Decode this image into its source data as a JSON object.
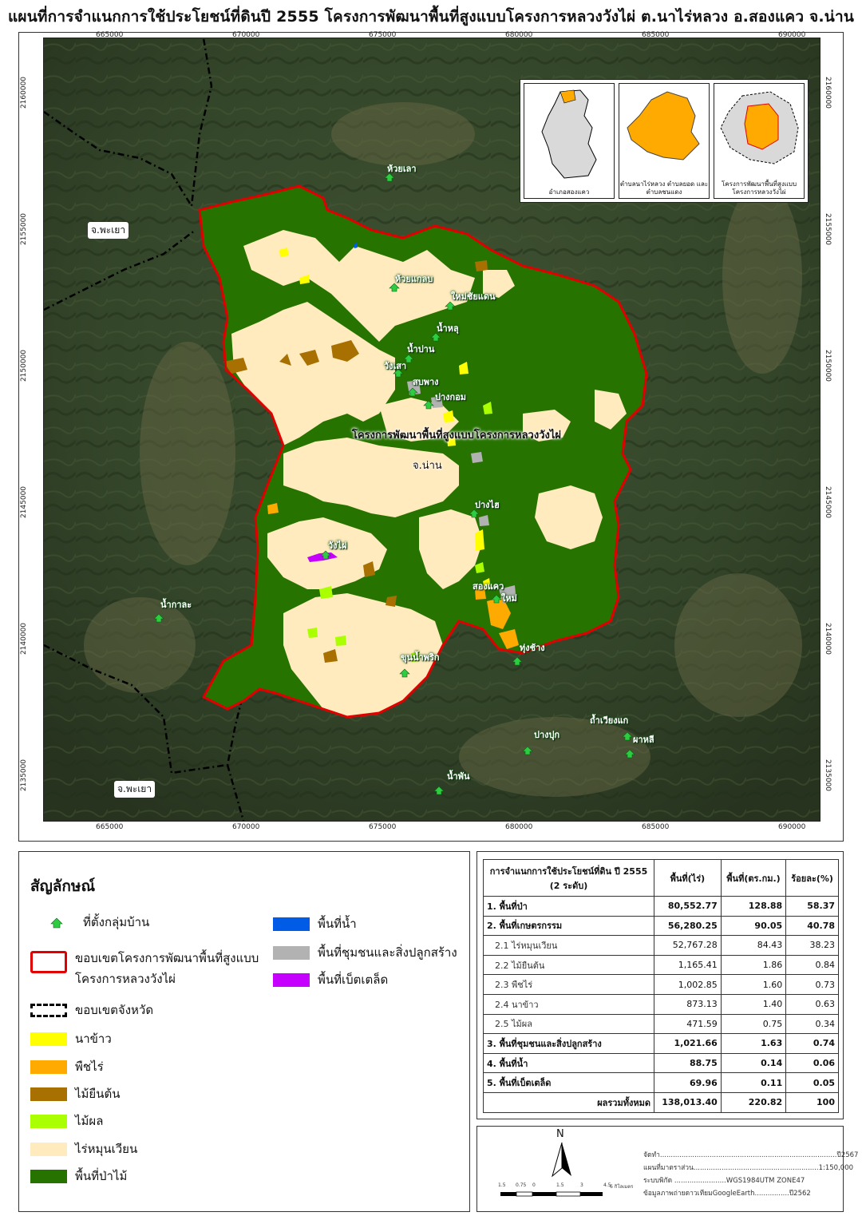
{
  "title": "แผนที่การจำแนกการใช้ประโยชน์ที่ดินปี 2555 โครงการพัฒนาพื้นที่สูงแบบโครงการหลวงวังไผ่ ต.นาไร่หลวง อ.สองแคว จ.น่าน",
  "ticks": {
    "x": [
      "665000",
      "670000",
      "675000",
      "680000",
      "685000",
      "690000"
    ],
    "y": [
      "2160000",
      "2155000",
      "2150000",
      "2145000",
      "2140000",
      "2135000"
    ]
  },
  "map_labels": {
    "provinces": [
      "จ.พะเยา",
      "จ.พะเยา",
      "จ.น่าน"
    ],
    "project": "โครงการพัฒนาพื้นที่สูงแบบโครงการหลวงวังไผ่",
    "villages": [
      "ห้วยเลา",
      "ห้วยแกลบ",
      "ใหม่ชัยแดน",
      "น้ำหลุ",
      "น้ำปาน",
      "วังเสา",
      "สบพาง",
      "ปางกอม",
      "ปางไฮ",
      "วังไผ่",
      "สองแคว",
      "ใหม่",
      "น้ำกาละ",
      "ทุ่งช้าง",
      "ขุนน้ำพริก",
      "ถ้ำเวียงแก",
      "ผาหลี",
      "ปางปุก",
      "น้ำพัน"
    ]
  },
  "insets": [
    {
      "caption": "อำเภอสองแคว"
    },
    {
      "caption": "ตำบลนาไร่หลวง ตำบลยอด และตำบลชนแดง"
    },
    {
      "caption": "โครงการพัฒนาพื้นที่สูงแบบ โครงการหลวงวังไผ่"
    }
  ],
  "legend": {
    "title": "สัญลักษณ์",
    "items": [
      {
        "label": "ที่ตั้งกลุ่มบ้าน",
        "color": "#2ecc40"
      },
      {
        "label": "ขอบเขตโครงการพัฒนาพื้นที่สูงแบบ",
        "label2": "โครงการหลวงวังไผ่",
        "color": "#e00000"
      },
      {
        "label": "ขอบเขตจังหวัด",
        "color": "#000000"
      },
      {
        "label": "นาข้าว",
        "color": "#ffff00"
      },
      {
        "label": "พืชไร่",
        "color": "#ffaa00"
      },
      {
        "label": "ไม้ยืนต้น",
        "color": "#a87000"
      },
      {
        "label": "ไม้ผล",
        "color": "#aaff00"
      },
      {
        "label": "ไร่หมุนเวียน",
        "color": "#ffebbe"
      },
      {
        "label": "พื้นที่ป่าไม้",
        "color": "#267300"
      },
      {
        "label": "พื้นที่น้ำ",
        "color": "#005ce6"
      },
      {
        "label": "พื้นที่ชุมชนและสิ่งปลูกสร้าง",
        "color": "#b2b2b2"
      },
      {
        "label": "พื้นที่เบ็ตเตล็ด",
        "color": "#c500ff"
      }
    ]
  },
  "table": {
    "headers": [
      "การจำแนกการใช้ประโยชน์ที่ดิน ปี 2555 (2 ระดับ)",
      "พื้นที่(ไร่)",
      "พื้นที่(ตร.กม.)",
      "ร้อยละ(%)"
    ],
    "rows": [
      {
        "name": "1. พื้นที่ป่า",
        "rai": "80,552.77",
        "km": "128.88",
        "pct": "58.37",
        "bold": true
      },
      {
        "name": "2. พื้นที่เกษตรกรรม",
        "rai": "56,280.25",
        "km": "90.05",
        "pct": "40.78",
        "bold": true
      },
      {
        "name": "2.1 ไร่หมุนเวียน",
        "rai": "52,767.28",
        "km": "84.43",
        "pct": "38.23",
        "bold": false
      },
      {
        "name": "2.2 ไม้ยืนต้น",
        "rai": "1,165.41",
        "km": "1.86",
        "pct": "0.84",
        "bold": false
      },
      {
        "name": "2.3 พืชไร่",
        "rai": "1,002.85",
        "km": "1.60",
        "pct": "0.73",
        "bold": false
      },
      {
        "name": "2.4 นาข้าว",
        "rai": "873.13",
        "km": "1.40",
        "pct": "0.63",
        "bold": false
      },
      {
        "name": "2.5 ไม้ผล",
        "rai": "471.59",
        "km": "0.75",
        "pct": "0.34",
        "bold": false
      },
      {
        "name": "3. พื้นที่ชุมชนและสิ่งปลูกสร้าง",
        "rai": "1,021.66",
        "km": "1.63",
        "pct": "0.74",
        "bold": true
      },
      {
        "name": "4. พื้นที่น้ำ",
        "rai": "88.75",
        "km": "0.14",
        "pct": "0.06",
        "bold": true
      },
      {
        "name": "5. พื้นที่เบ็ตเตล็ด",
        "rai": "69.96",
        "km": "0.11",
        "pct": "0.05",
        "bold": true
      }
    ],
    "total": {
      "name": "ผลรวมทั้งหมด",
      "rai": "138,013.40",
      "km": "220.82",
      "pct": "100"
    }
  },
  "meta": {
    "north": "N",
    "lines": [
      "จัดทำ..................................................................................ปี2567",
      "แผนที่มาตราส่วน..........................................................1:150,000",
      "ระบบพิกัด ........................WGS1984UTM ZONE47",
      "ข้อมูลภาพถ่ายดาวเทียมGoogleEarth................ปี2562"
    ],
    "scale": [
      "1.5",
      "0.75",
      "0",
      "1.5",
      "3",
      "4.5",
      "6 กิโลเมตร"
    ]
  }
}
